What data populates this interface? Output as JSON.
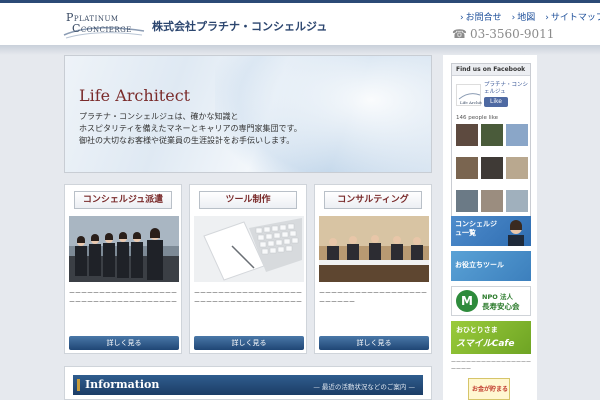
{
  "header": {
    "logo_line1": "PLATINUM",
    "logo_line2": "CONCIERGE",
    "company": "株式会社プラチナ・コンシェルジュ",
    "links": [
      "お問合せ",
      "地図",
      "サイトマップ"
    ],
    "phone": "03-3560-9011"
  },
  "hero": {
    "title": "Life Architect",
    "lines": [
      "プラチナ・コンシェルジュは、確かな知識と",
      "ホスピタリティを備えたマネーとキャリアの専門家集団です。",
      "御社の大切なお客様や従業員の生涯設計をお手伝いします。"
    ]
  },
  "cards": [
    {
      "title": "コンシェルジュ派遣",
      "text": "ーーーーーーーーーーーーーーーーーーーーーーーーーーーーーーーーーーーー",
      "button": "詳しく見る"
    },
    {
      "title": "ツール制作",
      "text": "ーーーーーーーーーーーーーーーーーーーーーーーーーーーーーーーーーーーー",
      "button": "詳しく見る"
    },
    {
      "title": "コンサルティング",
      "text": "ーーーーーーーーーーーーーーーーーーーーーーーー",
      "button": "詳しく見る"
    }
  ],
  "info": {
    "title": "Information",
    "subtitle": "— 最近の活動状況などのご案内 —"
  },
  "sidebar": {
    "fb_header": "Find us on Facebook",
    "fb_page_name": "プラチナ・コンシェルジュ",
    "fb_like": "Like",
    "fb_count": "146 people like",
    "banners": {
      "b1": "コンシェルジュ一覧",
      "b2": "お役立ちツール",
      "b3_line1": "NPO 法人",
      "b3_line2": "長寿安心会",
      "b4_line1": "おひとりさま",
      "b4_line2": "スマイルCafe"
    },
    "note": "ーーーーーーーーーーーーーーーーーーーー",
    "small_banner": "お金が貯まる"
  },
  "colors": {
    "brand_navy": "#2b4a76",
    "accent_red": "#7a2b2b",
    "button_blue": "#1f4675",
    "facebook_blue": "#4e69a2"
  }
}
